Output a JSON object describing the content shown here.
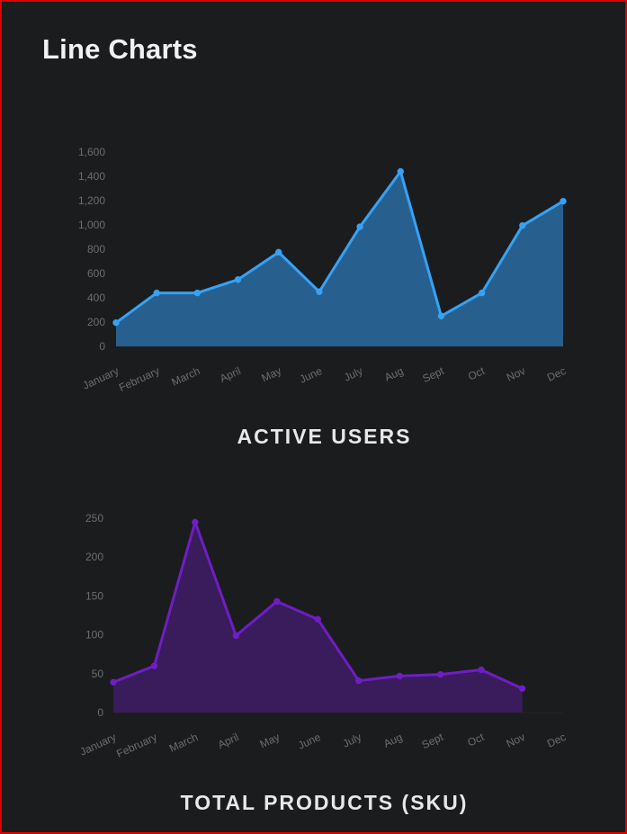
{
  "page": {
    "title": "Line Charts"
  },
  "chart_data": [
    {
      "type": "area",
      "title": "ACTIVE USERS",
      "categories": [
        "January",
        "February",
        "March",
        "April",
        "May",
        "June",
        "July",
        "Aug",
        "Sept",
        "Oct",
        "Nov",
        "Dec"
      ],
      "series": [
        {
          "values": [
            195,
            440,
            440,
            550,
            775,
            450,
            985,
            1440,
            250,
            440,
            995,
            1195
          ],
          "line_color": "#36a2f5",
          "fill_color": "#27608f"
        }
      ],
      "ylim": [
        0,
        1600
      ],
      "yticks": [
        0,
        200,
        400,
        600,
        800,
        1000,
        1200,
        1400,
        1600
      ],
      "ytick_labels": [
        "0",
        "200",
        "400",
        "600",
        "800",
        "1,000",
        "1,200",
        "1,400",
        "1,600"
      ],
      "grid": false
    },
    {
      "type": "area",
      "title": "TOTAL PRODUCTS (SKU)",
      "categories": [
        "January",
        "February",
        "March",
        "April",
        "May",
        "June",
        "July",
        "Aug",
        "Sept",
        "Oct",
        "Nov",
        "Dec"
      ],
      "series": [
        {
          "values": [
            39,
            60,
            245,
            99,
            143,
            120,
            41,
            47,
            49,
            55,
            31,
            null
          ],
          "line_color": "#6e1ec4",
          "fill_color": "#3a1b5c"
        }
      ],
      "ylim": [
        0,
        250
      ],
      "yticks": [
        0,
        50,
        100,
        150,
        200,
        250
      ],
      "ytick_labels": [
        "0",
        "50",
        "100",
        "150",
        "200",
        "250"
      ],
      "grid": false
    }
  ]
}
